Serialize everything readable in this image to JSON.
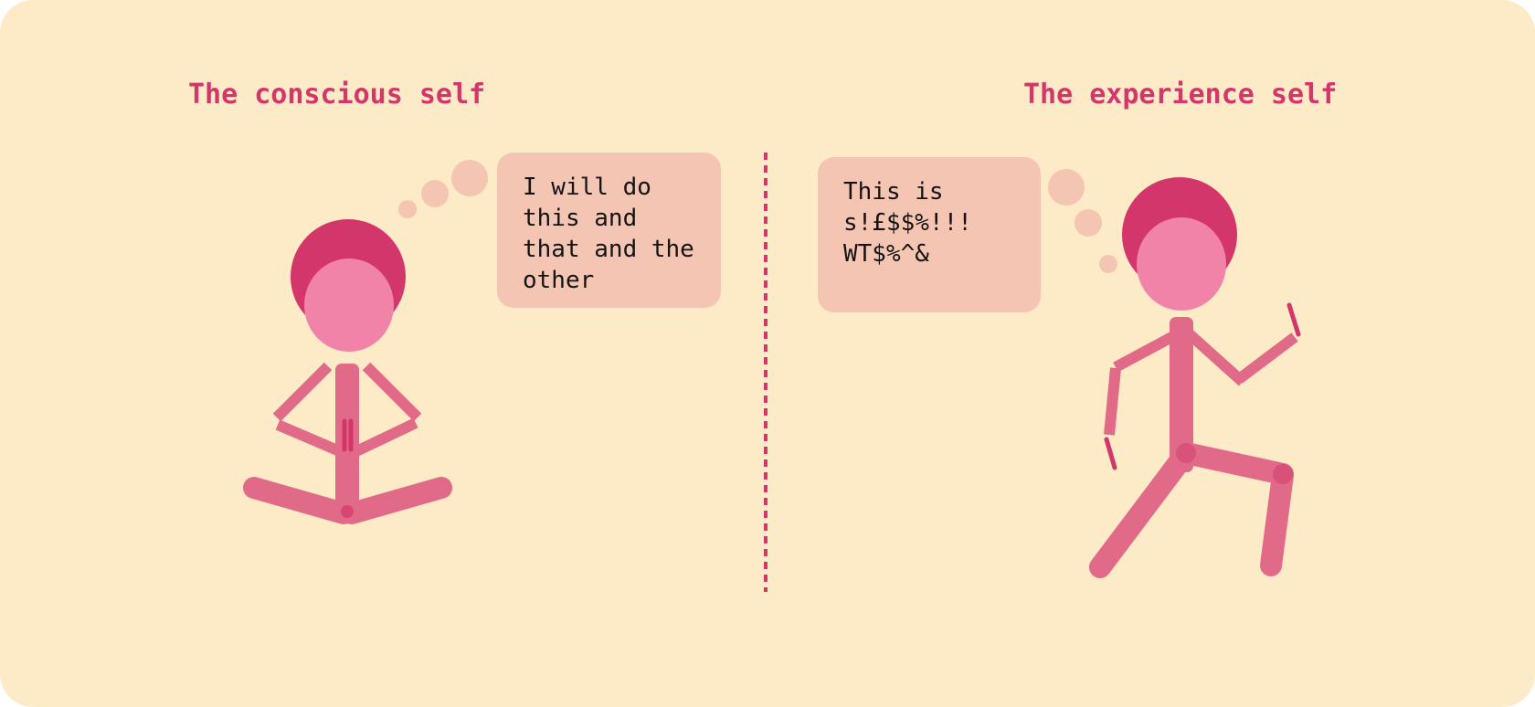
{
  "colors": {
    "background": "#fcebc6",
    "accent": "#d3366a",
    "skin": "#f283a8",
    "limb": "#e06a88",
    "bubble": "#f4c5b2",
    "text": "#141414"
  },
  "left_panel": {
    "title": "The conscious self",
    "thought": "I will do\nthis and\nthat and the\nother"
  },
  "right_panel": {
    "title": "The experience self",
    "thought": "This is\ns!£$$%!!!\nWT$%^&"
  }
}
